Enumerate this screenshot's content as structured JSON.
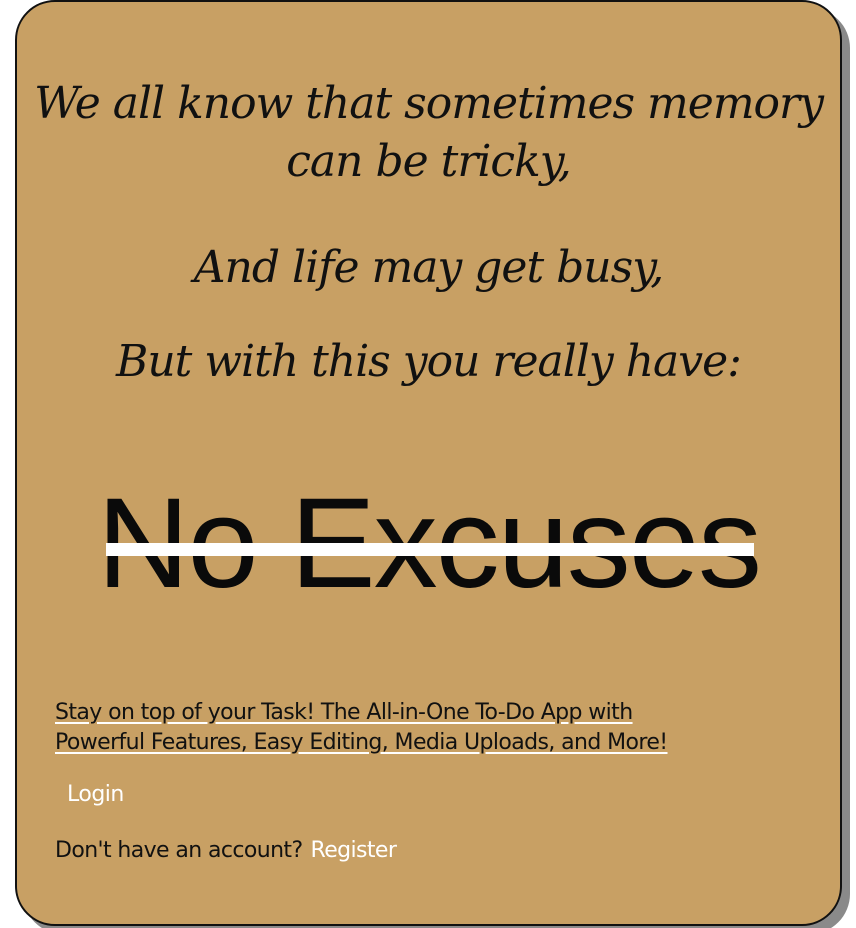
{
  "poem": {
    "line1": "We all know that sometimes memory",
    "line2": "can be tricky,",
    "line3": "And life may get busy,",
    "line4": "But with this you really have:"
  },
  "headline": "No Excuses",
  "tagline": {
    "line1": "Stay on top of your Task! The All-in-One To-Do App with",
    "line2": "Powerful Features, Easy Editing, Media Uploads, and More!"
  },
  "auth": {
    "login_label": "Login",
    "no_account_text": "Don't have an account?",
    "register_label": "Register"
  },
  "colors": {
    "card_background": "#c8a064",
    "accent_text": "#ffffff"
  }
}
